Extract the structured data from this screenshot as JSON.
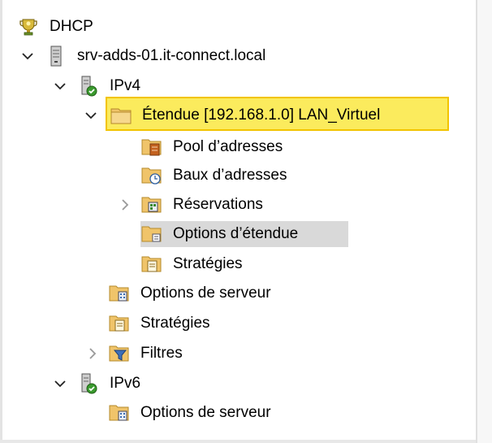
{
  "tree": {
    "root": {
      "label": "DHCP",
      "icon": "dhcp-trophy-icon"
    },
    "server": {
      "label": "srv-adds-01.it-connect.local",
      "icon": "server-tower-icon",
      "expanded": true
    },
    "ipv4": {
      "label": "IPv4",
      "icon": "ipv4-node-icon",
      "expanded": true,
      "scope": {
        "label": "Étendue [192.168.1.0] LAN_Virtuel",
        "icon": "scope-folder-icon",
        "expanded": true,
        "highlighted": true,
        "children": [
          {
            "label": "Pool d’adresses",
            "icon": "address-pool-icon"
          },
          {
            "label": "Baux d’adresses",
            "icon": "address-leases-icon"
          },
          {
            "label": "Réservations",
            "icon": "reservations-icon",
            "collapsed": true
          },
          {
            "label": "Options d’étendue",
            "icon": "scope-options-icon",
            "hover": true
          },
          {
            "label": "Stratégies",
            "icon": "policies-icon"
          }
        ]
      },
      "server_options": {
        "label": "Options de serveur",
        "icon": "server-options-icon"
      },
      "policies": {
        "label": "Stratégies",
        "icon": "policies-icon"
      },
      "filters": {
        "label": "Filtres",
        "icon": "filters-icon",
        "collapsed": true
      }
    },
    "ipv6": {
      "label": "IPv6",
      "icon": "ipv6-node-icon",
      "expanded": true,
      "server_options": {
        "label": "Options de serveur",
        "icon": "server-options-icon"
      }
    }
  },
  "colors": {
    "highlight_fill": "#fbeb5d",
    "highlight_border": "#f2c400",
    "hover_fill": "#d9d9d9",
    "folder": "#f0c46a",
    "check_green": "#3a9a2e"
  }
}
